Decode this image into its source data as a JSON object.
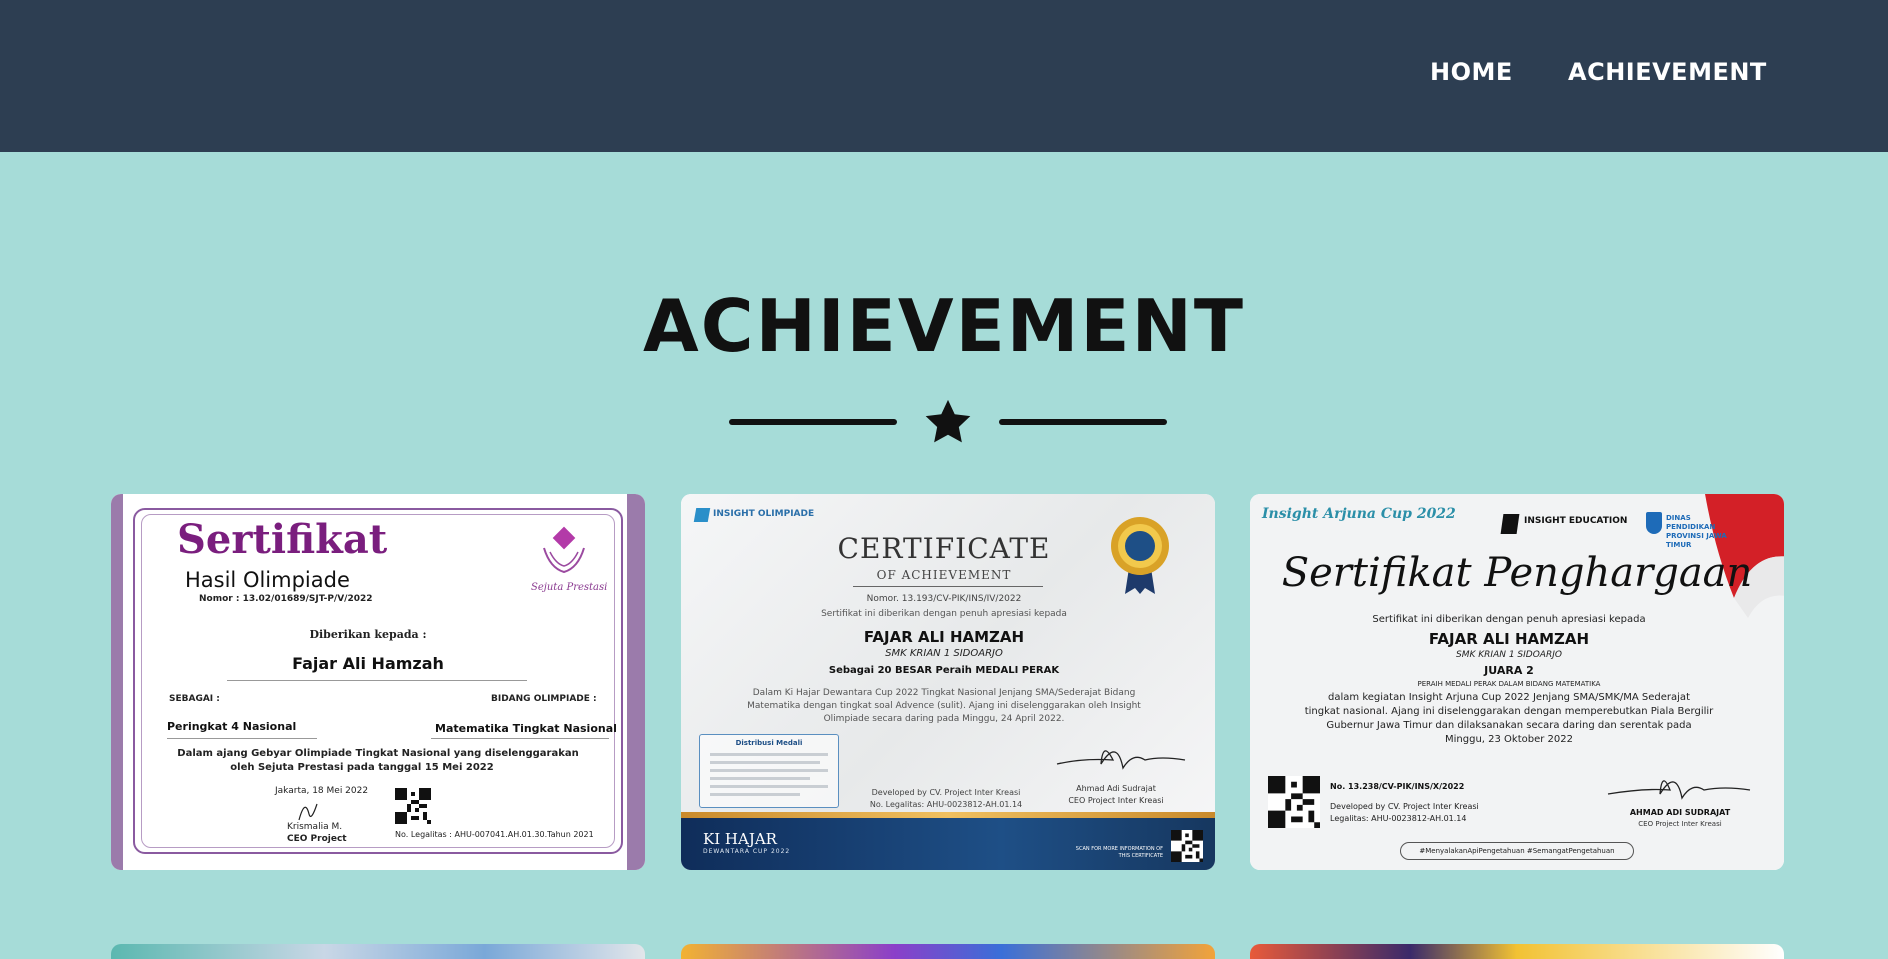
{
  "nav": {
    "home_label": "HOME",
    "achievement_label": "ACHIEVEMENT"
  },
  "section": {
    "title": "ACHIEVEMENT"
  },
  "certificates": [
    {
      "heading": "Sertifikat",
      "subheading": "Hasil Olimpiade",
      "number": "Nomor : 13.02/01689/SJT-P/V/2022",
      "given_to": "Diberikan kepada :",
      "name": "Fajar Ali Hamzah",
      "as_label": "SEBAGAI :",
      "field_label": "BIDANG OLIMPIADE :",
      "rank": "Peringkat 4 Nasional",
      "field": "Matematika Tingkat Nasional",
      "desc1": "Dalam ajang Gebyar Olimpiade Tingkat Nasional yang diselenggarakan",
      "desc2": "oleh Sejuta Prestasi pada tanggal 15 Mei 2022",
      "date": "Jakarta, 18 Mei 2022",
      "signer": "Krismalia M.",
      "signer_role": "CEO Project",
      "legal": "No. Legalitas :  AHU-007041.AH.01.30.Tahun 2021",
      "logo_text": "Sejuta Prestasi"
    },
    {
      "org": "INSIGHT OLIMPIADE",
      "heading": "CERTIFICATE",
      "subheading": "OF ACHIEVEMENT",
      "number": "Nomor. 13.193/CV-PIK/INS/IV/2022",
      "intro": "Sertifikat ini diberikan dengan penuh apresiasi kepada",
      "name": "FAJAR ALI HAMZAH",
      "school": "SMK KRIAN 1 SIDOARJO",
      "rank": "Sebagai 20 BESAR      Peraih MEDALI PERAK",
      "desc1": "Dalam Ki Hajar Dewantara Cup 2022 Tingkat Nasional Jenjang SMA/Sederajat Bidang",
      "desc2": "Matematika dengan tingkat soal Advence (sulit). Ajang ini diselenggarakan oleh Insight",
      "desc3": "Olimpiade secara daring pada Minggu, 24 April 2022.",
      "box_title": "Distribusi Medali",
      "dev": "Developed by CV. Project Inter Kreasi",
      "legal": "No. Legalitas: AHU-0023812-AH.01.14",
      "signer": "Ahmad Adi Sudrajat",
      "signer_role": "CEO Project Inter Kreasi",
      "footer_brand": "KI HAJAR",
      "footer_sub": "DEWANTARA CUP 2022",
      "footer_scan": "SCAN FOR MORE INFORMATION OF THIS CERTIFICATE"
    },
    {
      "logo": "Insight Arjuna Cup 2022",
      "org": "INSIGHT EDUCATION",
      "org2": "DINAS PENDIDIKAN PROVINSI JAWA TIMUR",
      "heading": "Sertifikat Penghargaan",
      "intro": "Sertifikat ini diberikan dengan penuh apresiasi kepada",
      "name": "FAJAR ALI HAMZAH",
      "school": "SMK KRIAN 1 SIDOARJO",
      "rank": "JUARA 2",
      "medal": "PERAIH MEDALI PERAK DALAM BIDANG MATEMATIKA",
      "desc1": "dalam kegiatan Insight Arjuna Cup 2022 Jenjang SMA/SMK/MA Sederajat",
      "desc2": "tingkat nasional. Ajang ini diselenggarakan dengan memperebutkan Piala Bergilir",
      "desc3": "Gubernur Jawa Timur dan dilaksanakan secara daring dan serentak pada",
      "desc4": "Minggu, 23 Oktober 2022",
      "number": "No. 13.238/CV-PIK/INS/X/2022",
      "dev": "Developed by CV. Project Inter Kreasi",
      "legal": "Legalitas: AHU-0023812-AH.01.14",
      "signer": "AHMAD ADI SUDRAJAT",
      "signer_role": "CEO Project Inter Kreasi",
      "tags": "#MenyalakanApiPengetahuan  #SemangatPengetahuan"
    }
  ],
  "colors": {
    "navbar": "#2d3e52",
    "background": "#a6dcd8",
    "title": "#111111"
  }
}
